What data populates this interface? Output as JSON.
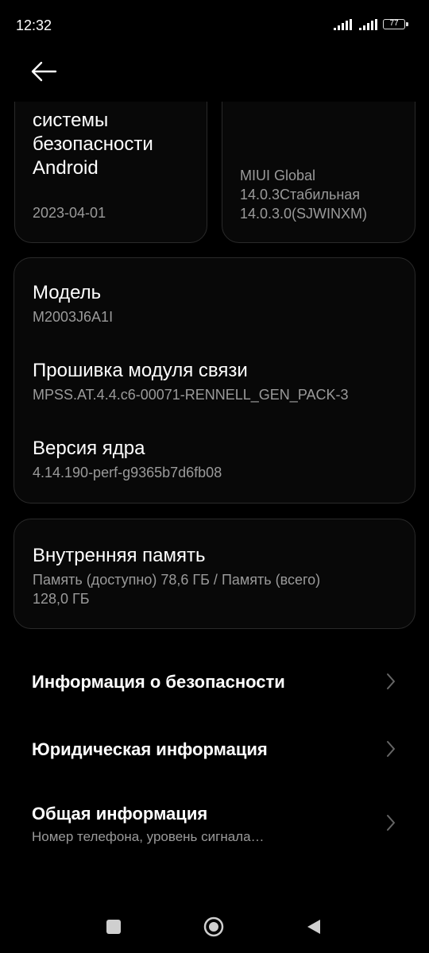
{
  "status_bar": {
    "time": "12:32",
    "battery": "77"
  },
  "cards": {
    "security_patch": {
      "title_lines": [
        "системы",
        "безопасности",
        "Android"
      ],
      "date": "2023-04-01"
    },
    "miui": {
      "version_lines": [
        "MIUI Global",
        "14.0.3Стабильная",
        "14.0.3.0(SJWINXM)"
      ]
    }
  },
  "device_info": {
    "model_label": "Модель",
    "model_value": "M2003J6A1I",
    "baseband_label": "Прошивка модуля связи",
    "baseband_value": "MPSS.AT.4.4.c6-00071-RENNELL_GEN_PACK-3",
    "kernel_label": "Версия ядра",
    "kernel_value": "4.14.190-perf-g9365b7d6fb08"
  },
  "storage": {
    "label": "Внутренняя память",
    "value_line1": "Память (доступно)  78,6 ГБ / Память (всего)",
    "value_line2": "128,0 ГБ"
  },
  "menu": [
    {
      "title": "Информация о безопасности",
      "subtitle": ""
    },
    {
      "title": "Юридическая информация",
      "subtitle": ""
    },
    {
      "title": "Общая информация",
      "subtitle": "Номер телефона, уровень сигнала…"
    }
  ],
  "icons": {
    "back": "arrow-left-icon",
    "chevron": "chevron-right-icon",
    "nav_recents": "square-icon",
    "nav_home": "circle-icon",
    "nav_back": "triangle-icon"
  },
  "colors": {
    "background": "#000000",
    "card": "#080808",
    "secondary_text": "#9a9a9a"
  }
}
